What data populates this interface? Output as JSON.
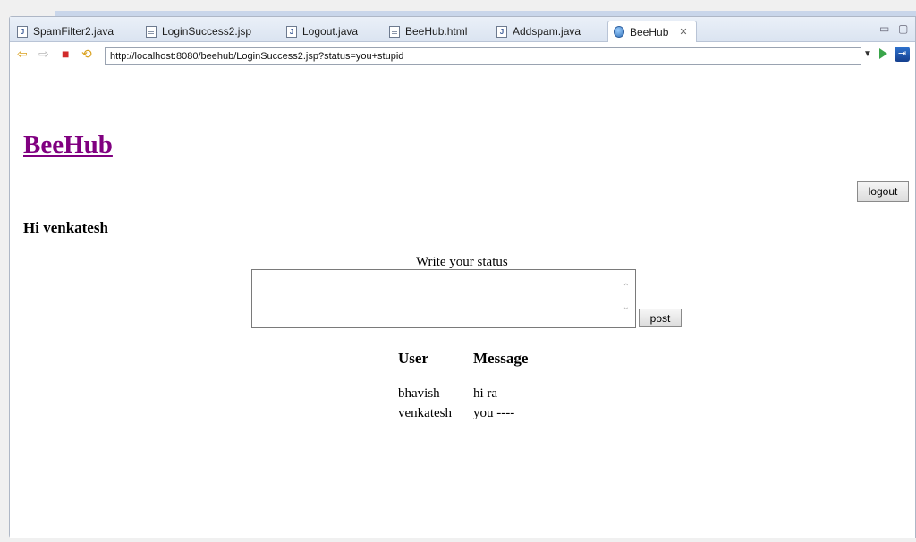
{
  "tabs": [
    {
      "label": "SpamFilter2.java"
    },
    {
      "label": "LoginSuccess2.jsp"
    },
    {
      "label": "Logout.java"
    },
    {
      "label": "BeeHub.html"
    },
    {
      "label": "Addspam.java"
    },
    {
      "label": "BeeHub",
      "active": true
    }
  ],
  "address": {
    "url": "http://localhost:8080/beehub/LoginSuccess2.jsp?status=you+stupid"
  },
  "page": {
    "brand": "BeeHub",
    "logout_label": "logout",
    "greeting": "Hi venkatesh",
    "status_label": "Write your status",
    "post_label": "post",
    "table": {
      "headers": [
        "User",
        "Message"
      ],
      "rows": [
        [
          "bhavish",
          "hi ra"
        ],
        [
          "venkatesh",
          "you ----"
        ]
      ]
    }
  },
  "colors": {
    "link": "#800080",
    "accent": "#2f74d0"
  }
}
